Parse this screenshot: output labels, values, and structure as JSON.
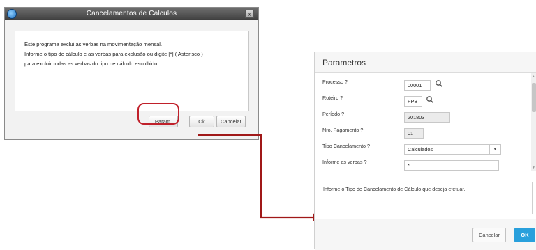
{
  "dialog1": {
    "title": "Cancelamentos de Cálculos",
    "message_lines": [
      "Este programa exclui as verbas na movimentação mensal.",
      "Informe o tipo de cálculo e as verbas para exclusão ou digite [*] ( Asterisco )",
      "para excluir todas as verbas do tipo de cálculo escolhido."
    ],
    "buttons": {
      "param": "Param.",
      "ok": "Ok",
      "cancel": "Cancelar"
    },
    "close_glyph": "x"
  },
  "dialog2": {
    "title": "Parametros",
    "fields": {
      "processo": {
        "label": "Processo ?",
        "value": "00001"
      },
      "roteiro": {
        "label": "Roteiro ?",
        "value": "FPB"
      },
      "periodo": {
        "label": "Período ?",
        "value": "201803"
      },
      "nro_pagamento": {
        "label": "Nro. Pagamento ?",
        "value": "01"
      },
      "tipo_cancelamento": {
        "label": "Tipo Cancelamento ?",
        "value": "Calculados"
      },
      "verbas": {
        "label": "Informe as verbas ?",
        "value": "*"
      }
    },
    "help_text": "Informe o Tipo de  Cancelamento  de  Cálculo que deseja efetuar.",
    "buttons": {
      "cancel": "Cancelar",
      "ok": "OK"
    }
  },
  "colors": {
    "highlight": "#c0202a",
    "connector": "#a01818",
    "ok_button": "#29a0dc",
    "title_bar": "#4a4a4a"
  },
  "icons": {
    "app": "app-globe-icon",
    "search": "search-icon",
    "dropdown": "chevron-down-icon",
    "close": "close-icon"
  }
}
